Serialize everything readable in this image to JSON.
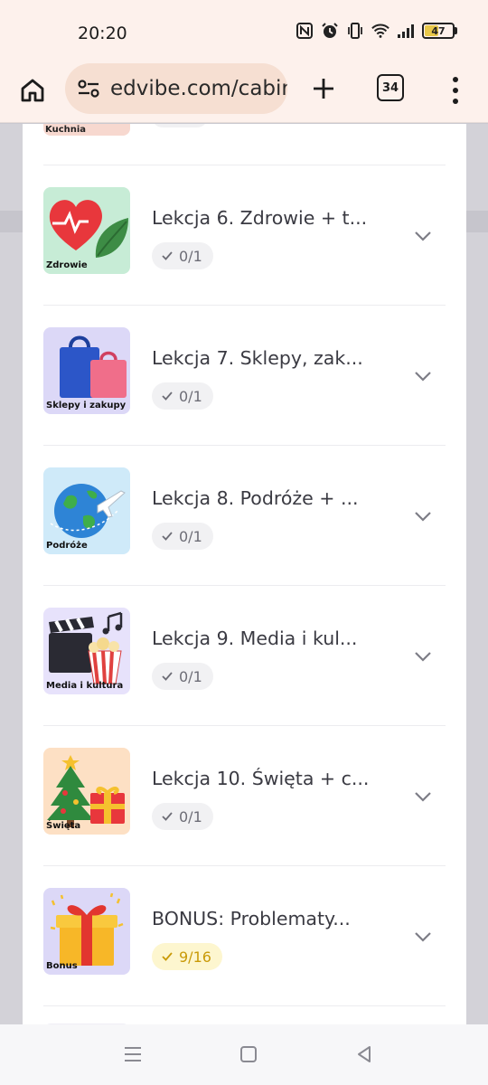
{
  "status_bar": {
    "time": "20:20",
    "battery": "47",
    "icons": [
      "nfc-icon",
      "alarm-icon",
      "vibrate-icon",
      "wifi-icon",
      "signal-icon",
      "battery-icon"
    ]
  },
  "browser": {
    "url": "edvibe.com/cabir",
    "tab_count": "34",
    "icons": [
      "home-icon",
      "site-settings-icon",
      "new-tab-plus-icon",
      "tab-switcher-icon",
      "more-menu-icon"
    ]
  },
  "lessons": [
    {
      "thumb_label": "Zdrowie",
      "title": "Lekcja 6. Zdrowie + t...",
      "progress": "0/1",
      "completed": false,
      "thumb_bg": "#c7ecd6",
      "icon": "heart-leaf-icon"
    },
    {
      "thumb_label": "Sklepy i zakupy",
      "title": "Lekcja 7. Sklepy, zak...",
      "progress": "0/1",
      "completed": false,
      "thumb_bg": "#dcd8f7",
      "icon": "shopping-bags-icon"
    },
    {
      "thumb_label": "Podróże",
      "title": "Lekcja 8. Podróże + ...",
      "progress": "0/1",
      "completed": false,
      "thumb_bg": "#cfeaf9",
      "icon": "globe-plane-icon"
    },
    {
      "thumb_label": "Media i kultura",
      "title": "Lekcja 9. Media i kul...",
      "progress": "0/1",
      "completed": false,
      "thumb_bg": "#e7e2fb",
      "icon": "clapper-popcorn-icon"
    },
    {
      "thumb_label": "Święta",
      "title": "Lekcja 10. Święta + c...",
      "progress": "0/1",
      "completed": false,
      "thumb_bg": "#fde0c4",
      "icon": "christmas-tree-gift-icon"
    },
    {
      "thumb_label": "Bonus",
      "title": "BONUS: Problematy...",
      "progress": "9/16",
      "completed": true,
      "thumb_bg": "#dcd8f7",
      "icon": "gift-box-icon"
    }
  ],
  "previous_lesson_peek": {
    "thumb_label": "Kuchnia"
  },
  "colors": {
    "badge_gray": "#f1f1f3",
    "badge_gold": "#fdf6cf",
    "gold_text": "#c99a08",
    "browser_bar": "#fdf1ec"
  },
  "nav_bar": {
    "icons": [
      "recent-apps-icon",
      "home-square-icon",
      "back-triangle-icon"
    ]
  }
}
